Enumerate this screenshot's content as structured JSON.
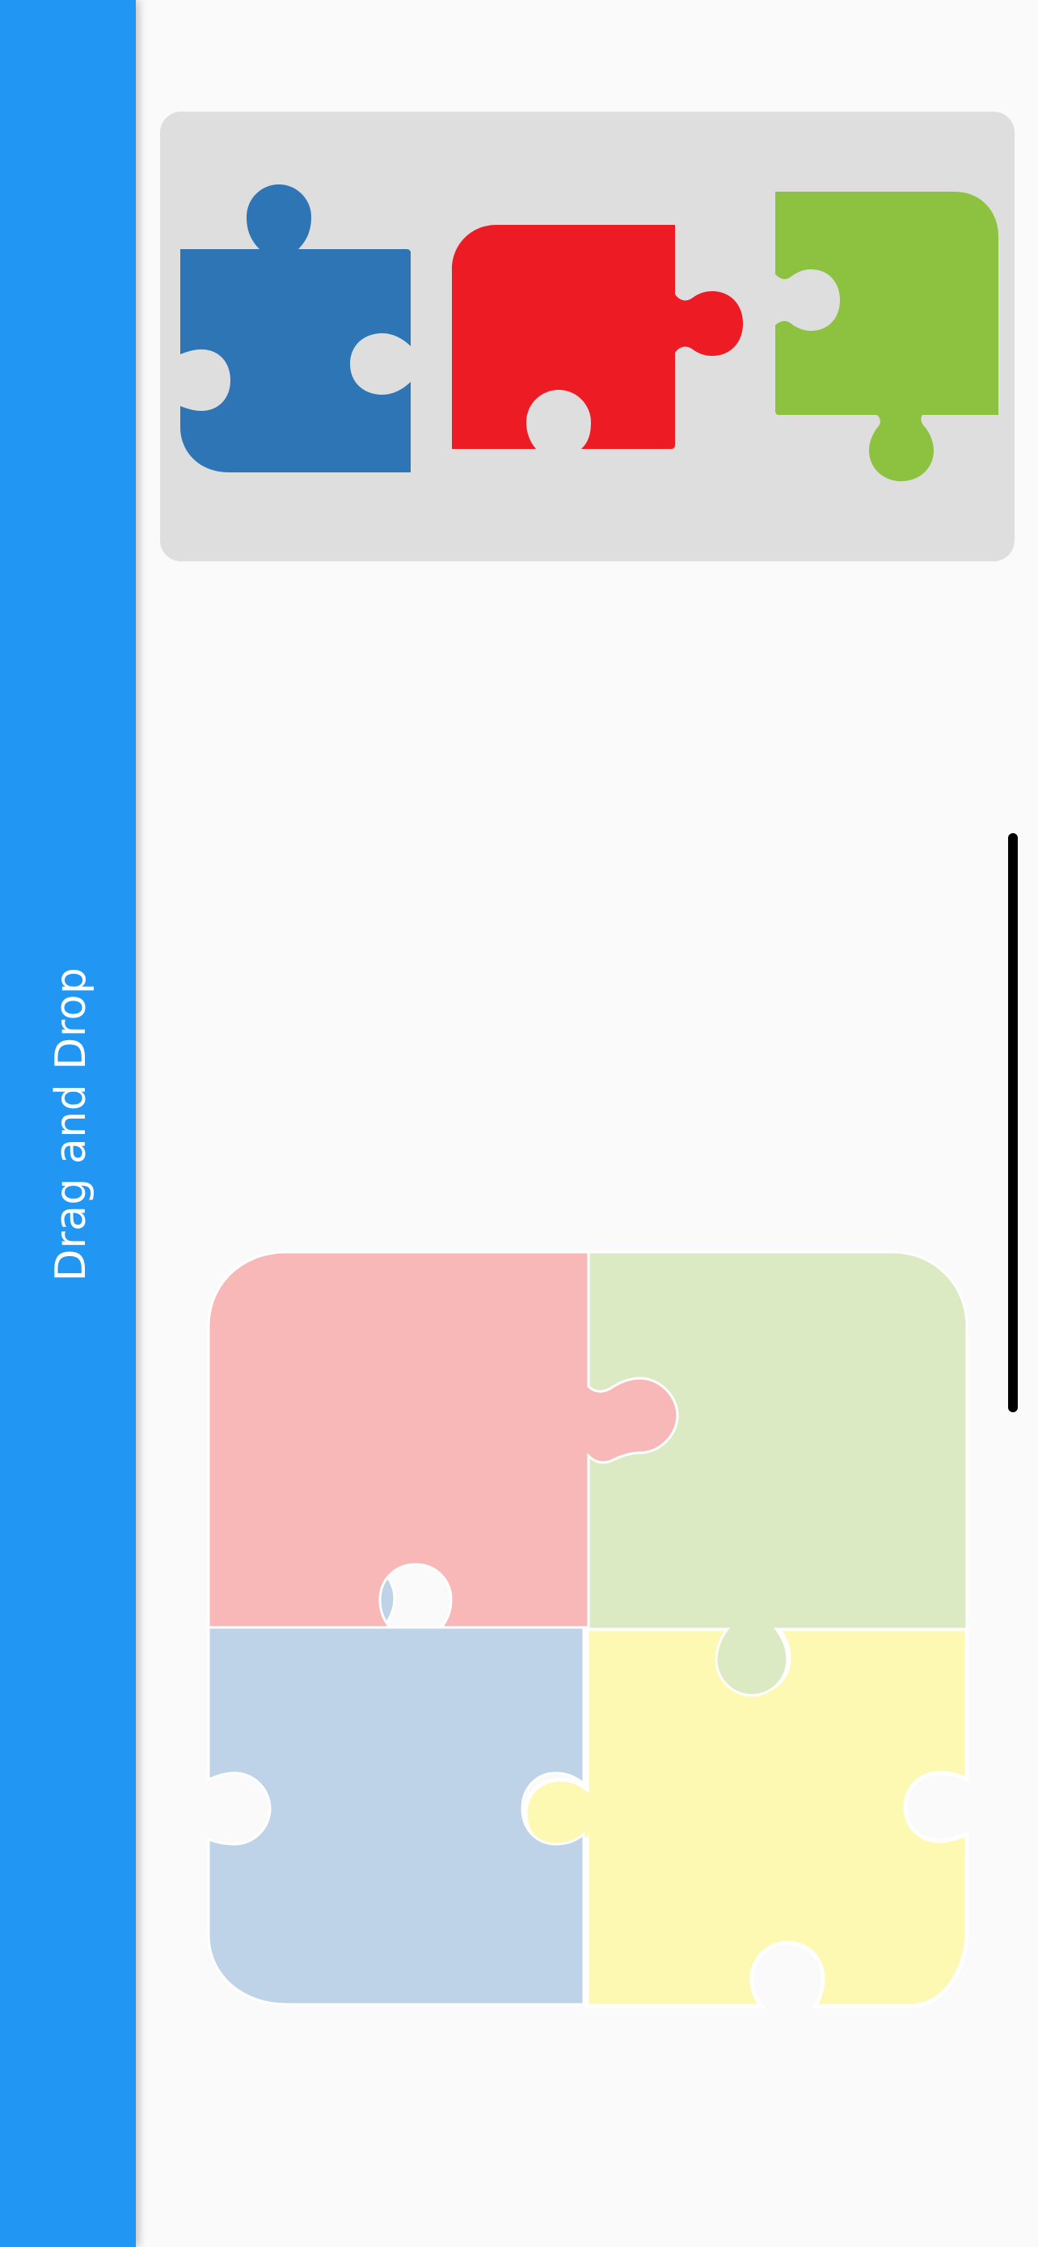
{
  "app_bar": {
    "title": "Drag and Drop",
    "color": "#2196f3",
    "title_color": "#ffffff"
  },
  "tray": {
    "background": "#dedede",
    "pieces": [
      {
        "name": "blue-puzzle-piece",
        "color": "#2e75b6"
      },
      {
        "name": "red-puzzle-piece",
        "color": "#ed1c24"
      },
      {
        "name": "green-puzzle-piece",
        "color": "#8dc140"
      }
    ]
  },
  "board": {
    "slots": [
      {
        "name": "top-left-slot",
        "color": "#f8b8b8"
      },
      {
        "name": "top-right-slot",
        "color": "#dbeac3"
      },
      {
        "name": "bottom-left-slot",
        "color": "#bfd3e8"
      },
      {
        "name": "bottom-right-slot",
        "color": "#fdf8b2"
      }
    ]
  },
  "scrollbar": {
    "color": "#000000"
  }
}
